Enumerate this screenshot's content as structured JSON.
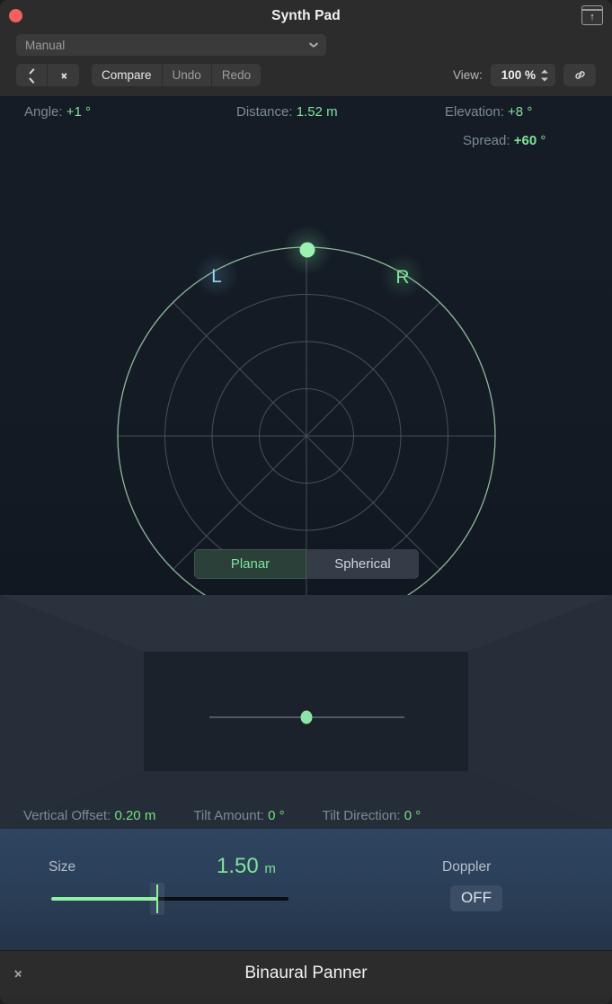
{
  "window": {
    "title": "Synth Pad",
    "close_icon": "close-dot",
    "detach_icon": "detach-window-icon"
  },
  "toolbar": {
    "preset": {
      "value": "Manual",
      "chevron_icon": "chevron-down-icon"
    },
    "prev_icon": "chevron-left-icon",
    "next_icon": "chevron-right-icon",
    "compare_label": "Compare",
    "undo_label": "Undo",
    "redo_label": "Redo",
    "view_label": "View:",
    "view_value": "100 %",
    "stepper_icon": "up-down-stepper-icon",
    "link_icon": "link-chain-icon"
  },
  "panner": {
    "angle": {
      "key": "Angle:",
      "value": "+1",
      "unit": "°"
    },
    "distance": {
      "key": "Distance:",
      "value": "1.52",
      "unit": "m"
    },
    "elevation": {
      "key": "Elevation:",
      "value": "+8",
      "unit": "°"
    },
    "spread": {
      "key": "Spread:",
      "value": "+60",
      "unit": "°"
    },
    "speaker_left": "L",
    "speaker_right": "R",
    "mode": {
      "planar": "Planar",
      "spherical": "Spherical",
      "selected": "Planar"
    }
  },
  "room": {
    "vertical_offset": {
      "key": "Vertical Offset:",
      "value": "0.20",
      "unit": "m"
    },
    "tilt_amount": {
      "key": "Tilt Amount:",
      "value": "0",
      "unit": "°"
    },
    "tilt_direction": {
      "key": "Tilt Direction:",
      "value": "0",
      "unit": "°"
    }
  },
  "size_section": {
    "size_label": "Size",
    "size_value": "1.50",
    "size_unit": "m",
    "doppler_label": "Doppler",
    "doppler_state": "OFF"
  },
  "footer": {
    "plugin_name": "Binaural Panner",
    "expand_icon": "chevron-right-icon"
  },
  "colors": {
    "accent_green": "#7ee49a",
    "speaker_left": "#8fd3f4",
    "speaker_right": "#7ee49a",
    "panner_bg": "#151c26",
    "size_bg": "#2b4059",
    "close_red": "#f3615c"
  },
  "chart_data": {
    "type": "scatter",
    "title": "Binaural Panner Position",
    "projection": "polar-top-down",
    "rings": [
      0.25,
      0.5,
      0.75,
      1.0
    ],
    "spoke_angles_deg": [
      0,
      45,
      90,
      135,
      180,
      225,
      270,
      315
    ],
    "source": {
      "angle_deg": 1,
      "distance_m": 1.52,
      "elevation_deg": 8,
      "spread_deg": 60,
      "radius_norm": 0.99
    },
    "speakers": [
      {
        "label": "L",
        "angle_deg": -30,
        "radius_norm": 1.0
      },
      {
        "label": "R",
        "angle_deg": 30,
        "radius_norm": 1.0
      }
    ],
    "vertical_view": {
      "vertical_offset_m": 0.2,
      "tilt_amount_deg": 0,
      "tilt_direction_deg": 0,
      "dot_x_norm": 0.5,
      "dot_y_norm": 0.5
    },
    "size_slider": {
      "value": 1.5,
      "unit": "m",
      "min": 0,
      "max": 5,
      "fill_norm": 0.45
    }
  }
}
